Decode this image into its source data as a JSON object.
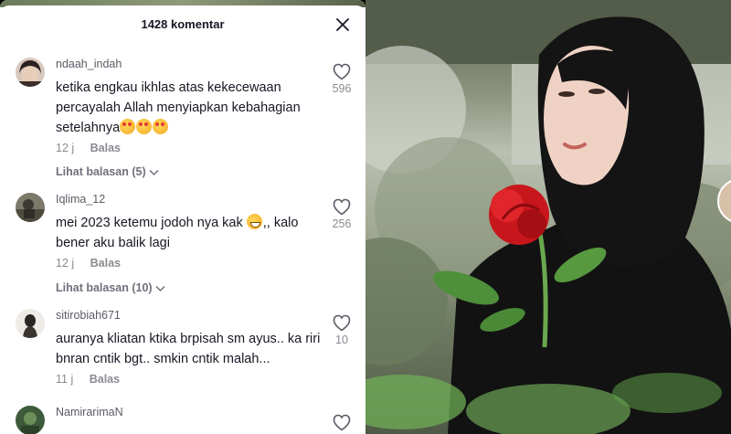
{
  "header": {
    "title": "1428 komentar",
    "close_icon": "close-icon"
  },
  "comments": [
    {
      "username": "ndaah_indah",
      "text": "ketika engkau ikhlas atas kekecewaan percayalah Allah menyiapkan kebahagian setelahnya",
      "emojis": [
        "smiling-face-with-hearts",
        "smiling-face-with-hearts",
        "smiling-face-with-hearts"
      ],
      "time": "12 j",
      "reply_label": "Balas",
      "view_replies": "Lihat balasan (5)",
      "likes": "596"
    },
    {
      "username": "Iqlima_12",
      "text_before": "mei 2023 ketemu jodoh nya kak",
      "emojis": [
        "grinning-face"
      ],
      "text_after": ",, kalo bener aku balik lagi",
      "time": "12 j",
      "reply_label": "Balas",
      "view_replies": "Lihat balasan (10)",
      "likes": "256"
    },
    {
      "username": "sitirobiah671",
      "text": "auranya kliatan ktika brpisah sm ayus.. ka riri bnran cntik bgt.. smkin cntik malah...",
      "time": "11 j",
      "reply_label": "Balas",
      "likes": "10"
    },
    {
      "username": "NamirarimaN",
      "text": "",
      "likes": ""
    }
  ],
  "colors": {
    "text": "#161823",
    "muted": "#8a8b91",
    "background": "#ffffff"
  }
}
